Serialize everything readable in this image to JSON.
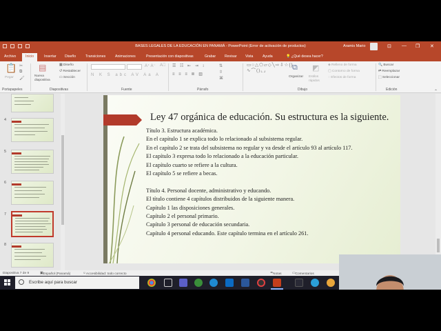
{
  "window": {
    "title": "BASES LEGALES DE LA EDUCACIÓN EN PANAMÁ  -  PowerPoint (Error de activación de productos)",
    "user": "Aramis  Mario",
    "minimize": "—",
    "restore": "❐",
    "close": "✕"
  },
  "tabs": [
    "Archivo",
    "Inicio",
    "Insertar",
    "Diseño",
    "Transiciones",
    "Animaciones",
    "Presentación con diapositivas",
    "Grabar",
    "Revisar",
    "Vista",
    "Ayuda",
    "¿Qué desea hacer?"
  ],
  "ribbon": {
    "groups": [
      "Portapapeles",
      "Diapositivas",
      "Fuente",
      "Párrafo",
      "Dibujo",
      "Edición"
    ],
    "paste": "Pegar",
    "new_slide": "Nueva diapositiva",
    "layout": "Diseño",
    "reset": "Restablecer",
    "section": "Sección",
    "arrange": "Organizar",
    "quick_styles": "Estilos rápidos",
    "shape_fill": "Relleno de forma",
    "shape_outline": "Contorno de forma",
    "shape_effects": "Efectos de forma",
    "find": "Buscar",
    "replace": "Reemplazar",
    "select": "Seleccionar"
  },
  "thumbnails": [
    {
      "number": "",
      "selected": false
    },
    {
      "number": "4",
      "selected": false
    },
    {
      "number": "5",
      "selected": false
    },
    {
      "number": "6",
      "selected": false
    },
    {
      "number": "7",
      "selected": true
    },
    {
      "number": "8",
      "selected": false
    }
  ],
  "slide": {
    "title": "Ley 47 orgánica de educación. Su estructura es la siguiente.",
    "lines": [
      "Título 3. Estructura académica.",
      "En el capítulo 1 se explica todo lo relacionado al subsistema regular.",
      "En el capítulo 2 se trata del subsistema no regular y va desde el artículo 93 al artículo 117.",
      "El capítulo 3 expresa todo lo relacionado a la educación particular.",
      "El capítulo cuarto se refiere a la cultura.",
      "El capítulo 5 se refiere a becas.",
      "",
      "Título 4. Personal docente, administrativo y educando.",
      "El título contiene 4 capítulos distribuidos de la siguiente manera.",
      "Capítulo 1 las disposiciones generales.",
      "Capítulo 2 el personal primario.",
      "Capítulo 3 personal de educación secundaria.",
      "Capítulo 4 personal educando. Este capítulo termina en el artículo 261."
    ]
  },
  "status": {
    "slide_counter": "Diapositiva 7 de 9",
    "language": "Español (Panamá)",
    "accessibility": "Accesibilidad: todo correcto",
    "notes": "Notas",
    "comments": "Comentarios"
  },
  "taskbar": {
    "search_placeholder": "Escribe aquí para buscar"
  },
  "colors": {
    "accent": "#b7472a",
    "slide_bar": "#b23a2b",
    "taskbar": "#1f1f2a"
  }
}
